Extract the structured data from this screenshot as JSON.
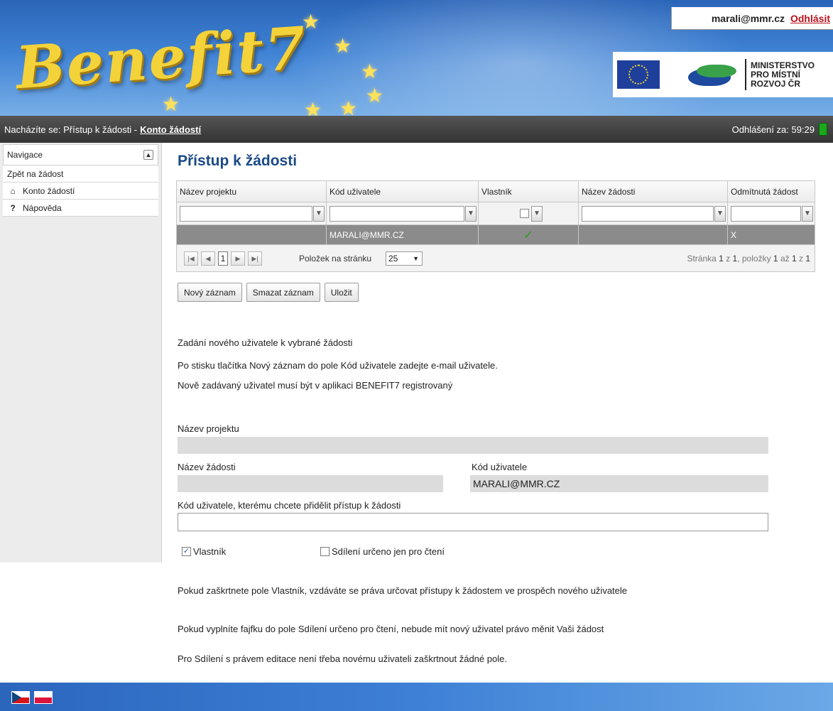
{
  "header": {
    "brand": "Benefit7",
    "user_email": "marali@mmr.cz",
    "logout_label": "Odhlásit",
    "ministry_line1": "MINISTERSTVO",
    "ministry_line2": "PRO MÍSTNÍ",
    "ministry_line3": "ROZVOJ ČR"
  },
  "breadcrumb": {
    "prefix": "Nacházíte se: Přístup k žádosti - ",
    "current": "Konto žádostí",
    "timer": "Odhlášení za: 59:29"
  },
  "sidebar": {
    "title": "Navigace",
    "items": [
      {
        "label": "Zpět na žádost",
        "icon": ""
      },
      {
        "label": "Konto žádostí",
        "icon": "home-icon"
      },
      {
        "label": "Nápověda",
        "icon": "help-icon"
      }
    ]
  },
  "main": {
    "title": "Přístup k žádosti",
    "grid": {
      "columns": [
        "Název projektu",
        "Kód uživatele",
        "Vlastník",
        "Název žádosti",
        "Odmítnutá žádost"
      ],
      "rows": [
        {
          "nazev_projektu": "",
          "kod_uzivatele": "MARALI@MMR.CZ",
          "vlastnik": "✓",
          "nazev_zadosti": "",
          "odmitnuta": "X"
        }
      ],
      "pager": {
        "page": "1",
        "per_page_label": "Položek na stránku",
        "per_page": "25",
        "info_prefix": "Stránka ",
        "info_page": "1",
        "info_of": " z ",
        "info_pages": "1",
        "info_items": ", položky ",
        "info_from": "1",
        "info_to_word": " až ",
        "info_to": "1",
        "info_z": " z ",
        "info_total": "1"
      }
    },
    "buttons": {
      "new": "Nový záznam",
      "delete": "Smazat záznam",
      "save": "Uložit"
    },
    "info": {
      "line1": "Zadání nového uživatele k vybrané žádosti",
      "line2": "Po stisku tlačítka Nový záznam do pole Kód uživatele zadejte e-mail uživatele.",
      "line3": "Nově zadávaný uživatel musí být v aplikaci BENEFIT7 registrovaný"
    },
    "form": {
      "nazev_projektu_label": "Název projektu",
      "nazev_projektu_value": "",
      "nazev_zadosti_label": "Název žádosti",
      "nazev_zadosti_value": "",
      "kod_uzivatele_label": "Kód uživatele",
      "kod_uzivatele_value": "MARALI@MMR.CZ",
      "grant_label": "Kód uživatele, kterému chcete přidělit přístup k žádosti",
      "grant_value": "",
      "vlastnik_label": "Vlastník",
      "vlastnik_checked": true,
      "readonly_label": "Sdílení určeno jen pro čtení",
      "readonly_checked": false
    },
    "notes": {
      "n1": "Pokud zaškrtnete pole Vlastník, vzdáváte se práva určovat přístupy k žádostem ve prospěch nového uživatele",
      "n2": "Pokud vyplníte fajfku do pole Sdílení určeno pro čtení, nebude mít nový uživatel právo měnit Vaši žádost",
      "n3": "Pro Sdílení s právem editace není třeba novému uživateli zaškrtnout žádné pole."
    }
  },
  "footer": {
    "languages": [
      "cz-flag",
      "pl-flag"
    ]
  }
}
